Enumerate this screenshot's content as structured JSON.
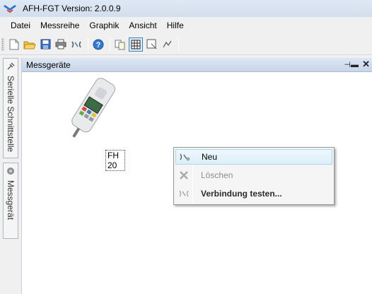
{
  "window": {
    "title": "AFH-FGT  Version: 2.0.0.9"
  },
  "menubar": {
    "items": [
      "Datei",
      "Messreihe",
      "Graphik",
      "Ansicht",
      "Hilfe"
    ]
  },
  "side_tabs": {
    "serial": "Serielle Schnittstelle",
    "device": "Messgerät"
  },
  "panel": {
    "title": "Messgeräte",
    "pin_symbol": "⊣▬",
    "close_symbol": "✕"
  },
  "device": {
    "label": "FH 20"
  },
  "context_menu": {
    "new": "Neu",
    "delete": "Löschen",
    "test": "Verbindung testen..."
  },
  "colors": {
    "accent": "#3c7fb1",
    "title_bar": "#dfe9f5",
    "highlight": "#dbeff9"
  }
}
